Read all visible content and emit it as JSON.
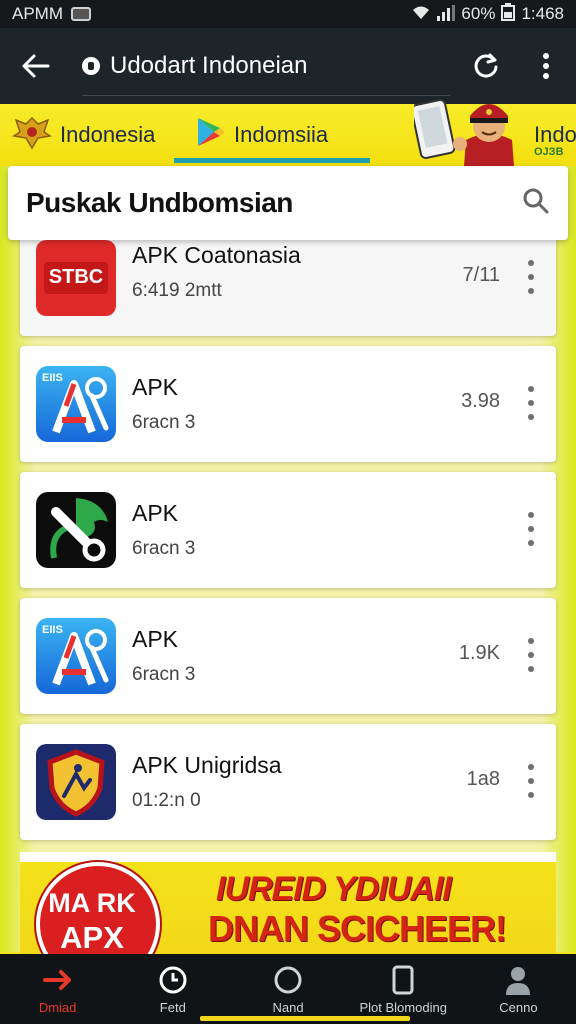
{
  "status_bar": {
    "time_left": "APMM",
    "battery": "60%",
    "time_right": "1:468"
  },
  "app_bar": {
    "url_text": "Udodart Indoneian"
  },
  "tabs": [
    {
      "label": "Indonesia",
      "icon": "emblem-icon"
    },
    {
      "label": "Indomsiia",
      "icon": "play-store-icon"
    },
    {
      "label": "Indo",
      "sub": "ОЈЗВ"
    }
  ],
  "search": {
    "title": "Puskak Undbomsian"
  },
  "apps": [
    {
      "name": "APK Coatonasia",
      "meta": "6:419 2mtt",
      "size": "7/11",
      "icon": "stbc-logo-icon",
      "icon_text": "STBC"
    },
    {
      "name": "APK",
      "meta": "6racn 3",
      "size": "3.98",
      "icon": "app-store-icon",
      "icon_text": "EIIS"
    },
    {
      "name": "APK",
      "meta": "6racn 3",
      "size": "",
      "icon": "wrench-icon"
    },
    {
      "name": "APK",
      "meta": "6racn 3",
      "size": "1.9K",
      "icon": "app-store-icon",
      "icon_text": "EIIS"
    },
    {
      "name": "APK Unigridsa",
      "meta": "01:2:n 0",
      "size": "1a8",
      "icon": "shield-icon"
    }
  ],
  "banner": {
    "badge_line1": "MA RK",
    "badge_line2": "APX",
    "headline1": "IUREID YDIUAII",
    "headline2": "DNAN SCICHEER!"
  },
  "bottom_nav": [
    {
      "label": "Dmiad",
      "icon": "arrow-icon",
      "active": true
    },
    {
      "label": "Fetd",
      "icon": "clock-icon"
    },
    {
      "label": "Nand",
      "icon": "circle-icon"
    },
    {
      "label": "Plot Blomoding",
      "icon": "phone-icon"
    },
    {
      "label": "Cenno",
      "icon": "person-icon"
    }
  ],
  "colors": {
    "accent_yellow": "#f2e21a",
    "dark_bar": "#1d2528",
    "red": "#d32414"
  }
}
